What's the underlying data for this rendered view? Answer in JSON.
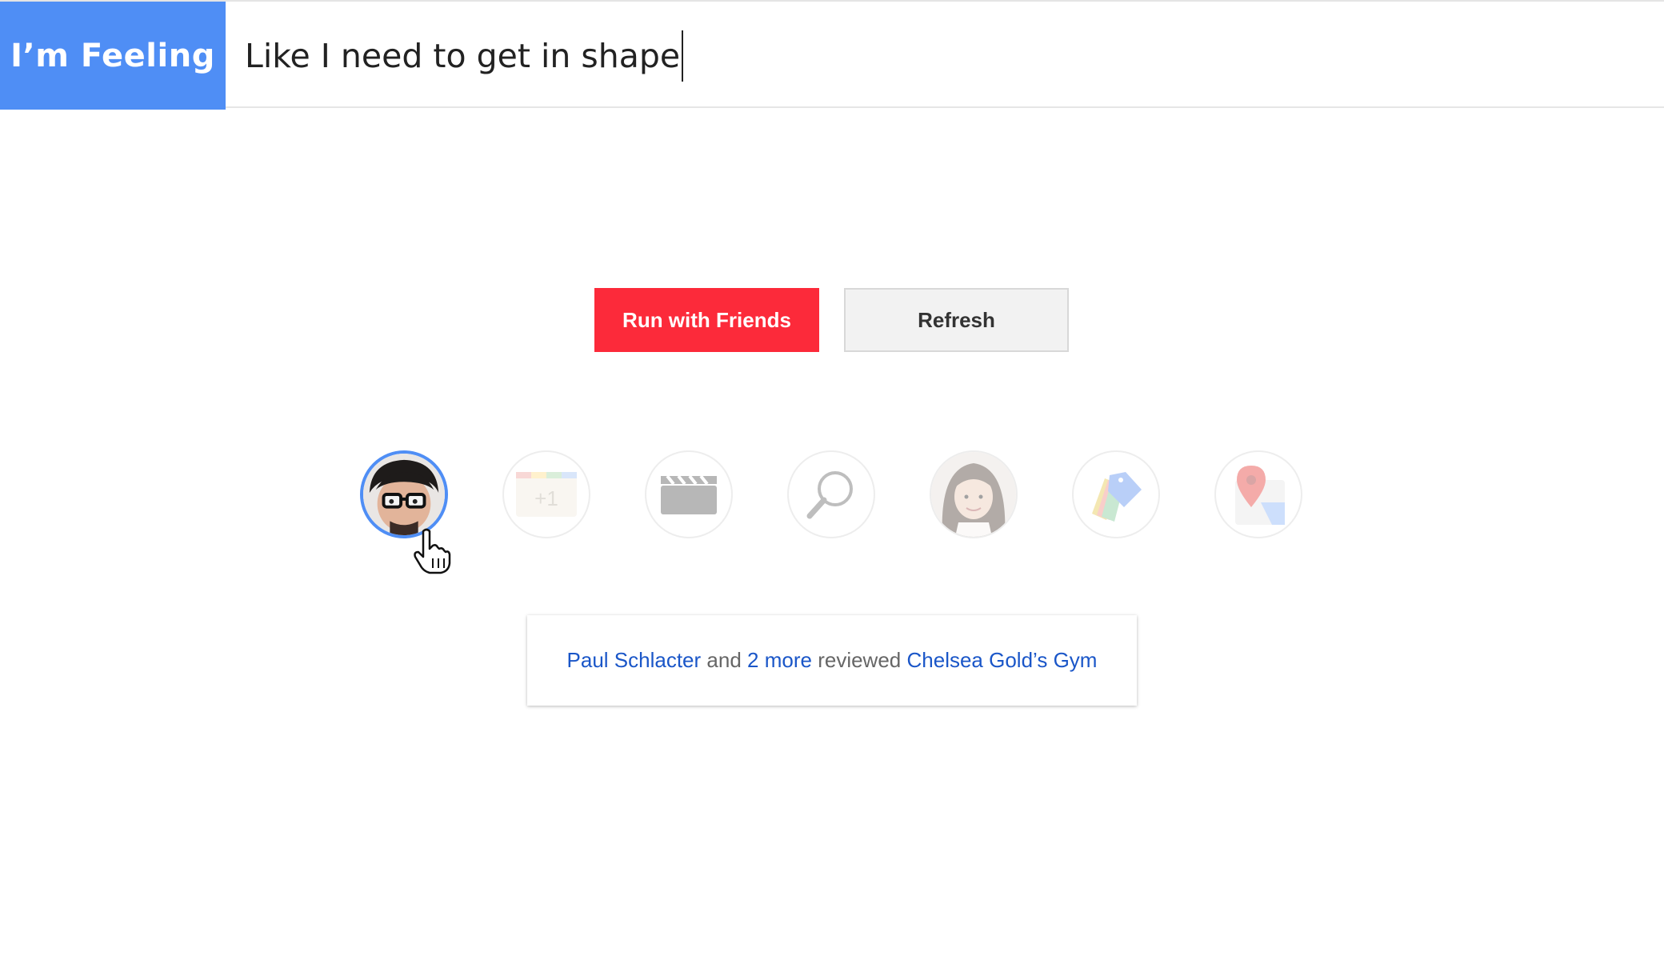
{
  "header": {
    "brand_label": "I’m Feeling",
    "query_value": "Like I need to get in shape"
  },
  "actions": {
    "primary_label": "Run with Friends",
    "secondary_label": "Refresh"
  },
  "result_icons": [
    {
      "name": "friend-avatar-paul",
      "icon": "person-avatar",
      "selected": true
    },
    {
      "name": "google-plus-calendar-icon",
      "icon": "calendar-plus-one"
    },
    {
      "name": "movies-clapperboard-icon",
      "icon": "clapperboard"
    },
    {
      "name": "search-icon",
      "icon": "magnifying-glass"
    },
    {
      "name": "friend-avatar-woman",
      "icon": "person-avatar"
    },
    {
      "name": "shopping-tags-icon",
      "icon": "price-tags"
    },
    {
      "name": "maps-icon",
      "icon": "map-pin"
    }
  ],
  "review_card": {
    "person": "Paul Schlacter",
    "and_text": "and",
    "more": "2 more",
    "reviewed_text": "reviewed",
    "place": "Chelsea Gold’s Gym"
  },
  "colors": {
    "brand": "#4f8ef5",
    "primary_button": "#fc2a3a",
    "link": "#1a56c8"
  }
}
